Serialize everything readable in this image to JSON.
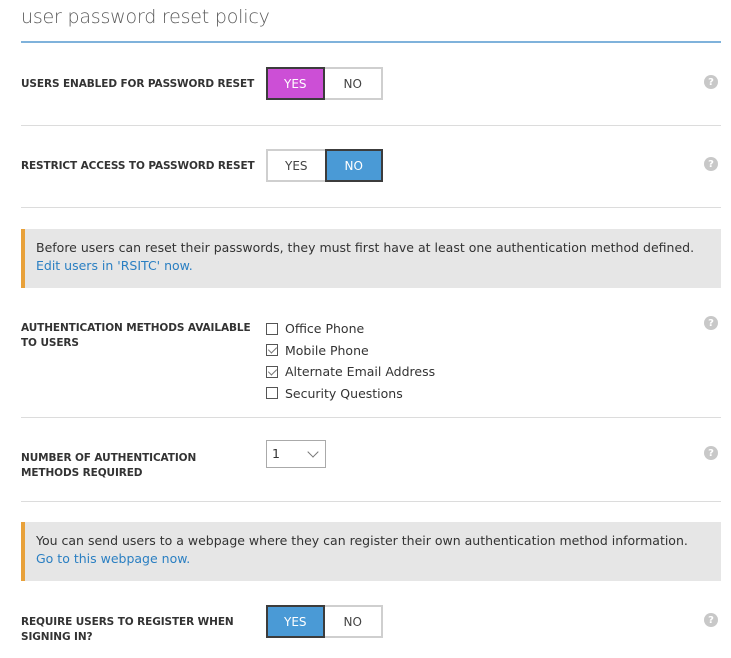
{
  "page": {
    "title": "user password reset policy"
  },
  "colors": {
    "accent_magenta": "#cc4fd6",
    "accent_blue": "#4a9ad6",
    "notice_border": "#e8a13a",
    "link": "#2a7fc2"
  },
  "settings": {
    "users_enabled": {
      "label": "USERS ENABLED FOR PASSWORD RESET",
      "yes_label": "YES",
      "no_label": "NO",
      "selected": "YES"
    },
    "restrict_access": {
      "label": "RESTRICT ACCESS TO PASSWORD RESET",
      "yes_label": "YES",
      "no_label": "NO",
      "selected": "NO"
    },
    "auth_methods": {
      "label": "AUTHENTICATION METHODS AVAILABLE TO USERS",
      "options": [
        {
          "label": "Office Phone",
          "checked": false
        },
        {
          "label": "Mobile Phone",
          "checked": true
        },
        {
          "label": "Alternate Email Address",
          "checked": true
        },
        {
          "label": "Security Questions",
          "checked": false
        }
      ]
    },
    "num_methods": {
      "label": "NUMBER OF AUTHENTICATION METHODS REQUIRED",
      "value": "1"
    },
    "require_register": {
      "label": "REQUIRE USERS TO REGISTER WHEN SIGNING IN?",
      "yes_label": "YES",
      "no_label": "NO",
      "selected": "YES"
    }
  },
  "notices": {
    "auth_notice": {
      "text": "Before users can reset their passwords, they must first have at least one authentication method defined. ",
      "link": "Edit users in 'RSITC' now."
    },
    "register_notice": {
      "text": "You can send users to a webpage where they can register their own authentication method information. ",
      "link": "Go to this webpage now."
    }
  },
  "help_icon_glyph": "?"
}
